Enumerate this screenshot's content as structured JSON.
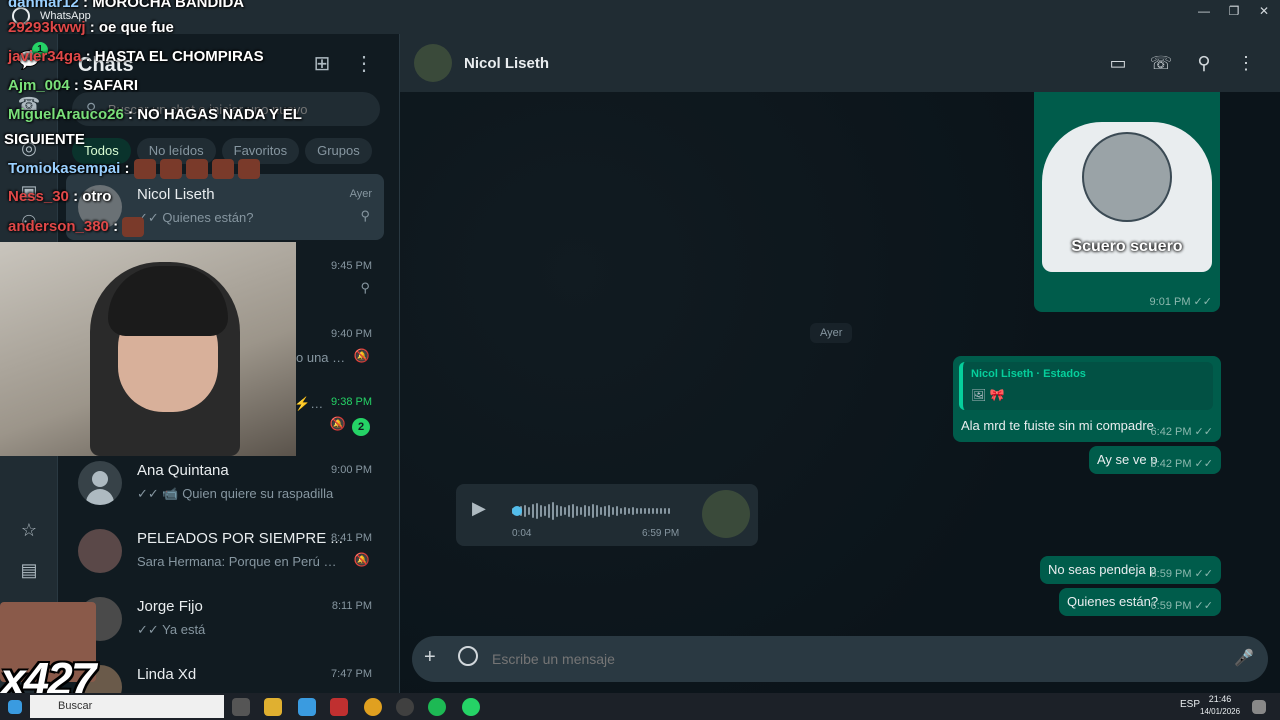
{
  "window": {
    "app_name": "WhatsApp",
    "minimize": "—",
    "maximize": "❐",
    "close": "✕"
  },
  "chatlist": {
    "title": "Chats",
    "search_placeholder": "Buscar un chat o iniciar uno nuevo",
    "filters": [
      "Todos",
      "No leídos",
      "Favoritos",
      "Grupos"
    ],
    "rows": [
      {
        "name": "Nicol Liseth",
        "time": "Ayer",
        "preview": "✓✓ Quienes están?",
        "meta": "pin"
      },
      {
        "name": "",
        "time": "9:45 PM",
        "preview": "",
        "meta": "pin"
      },
      {
        "name": "",
        "time": "9:40 PM",
        "preview": "o una di...",
        "meta": "muted"
      },
      {
        "name": "",
        "time": "9:38 PM",
        "preview": "⚡ ...",
        "meta": "muted",
        "unread": "2"
      },
      {
        "name": "Ana Quintana",
        "time": "9:00 PM",
        "preview": "✓✓ 📹 Quien quiere su raspadilla",
        "meta": ""
      },
      {
        "name": "PELEADOS POR SIEMPRE ...",
        "time": "8:41 PM",
        "preview": "Sara Hermana: Porque en Perú man...",
        "meta": "muted"
      },
      {
        "name": "Jorge Fijo",
        "time": "8:11 PM",
        "preview": "✓✓ Ya está",
        "meta": ""
      },
      {
        "name": "Linda Xd",
        "time": "7:47 PM",
        "preview": "",
        "meta": ""
      }
    ]
  },
  "conversation": {
    "contact_name": "Nicol Liseth",
    "sticker_caption": "Scuero scuero",
    "sticker_time": "9:01 PM ✓✓",
    "day_separator": "Ayer",
    "quote_name": "Nicol Liseth · Estados",
    "quote_icon": "🖼 🎀",
    "messages": [
      {
        "text": "Ala mrd te fuiste sin mi compadre",
        "time": "6:42 PM ✓✓"
      },
      {
        "text": "Ay se ve p",
        "time": "6:42 PM ✓✓"
      },
      {
        "text": "No seas pendeja p",
        "time": "6:59 PM ✓✓"
      },
      {
        "text": "Quienes están?",
        "time": "6:59 PM ✓✓"
      }
    ],
    "audio": {
      "duration": "0:04",
      "time": "6:59 PM"
    },
    "composer_placeholder": "Escribe un mensaje"
  },
  "stream_overlay": {
    "chat": [
      {
        "user": "danmar12",
        "text": ": MOROCHA BANDIDA"
      },
      {
        "user": "29293kwwj",
        "text": ": oe que fue"
      },
      {
        "user": "javier34ga",
        "text": ": HASTA EL CHOMPIRAS"
      },
      {
        "user": "Ajm_004",
        "text": ": SAFARI"
      },
      {
        "user": "MiguelArauco26",
        "text": ": NO HAGAS NADA Y EL"
      },
      {
        "user": "",
        "text": "SIGUIENTE"
      },
      {
        "user": "Tomiokasempai",
        "text": ":"
      },
      {
        "user": "Ness_30",
        "text": ": otro"
      },
      {
        "user": "anderson_380",
        "text": ":"
      }
    ],
    "bits_label": "x427"
  },
  "taskbar": {
    "search_label": "Buscar",
    "language": "ESP",
    "clock_time": "21:46",
    "clock_date": "14/01/2026"
  },
  "colors": {
    "accent": "#25d366",
    "outgoing_bubble": "#005c4b",
    "background": "#0b141a"
  }
}
